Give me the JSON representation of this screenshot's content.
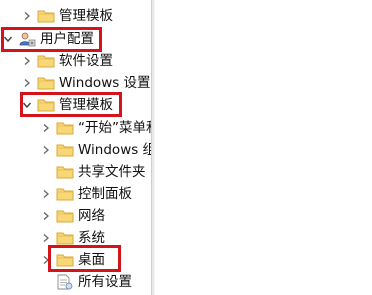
{
  "tree": {
    "items": [
      {
        "label": "管理模板",
        "icon": "folder-icon",
        "expander": "collapsed"
      },
      {
        "label": "用户配置",
        "icon": "user-config-icon",
        "expander": "expanded"
      },
      {
        "label": "软件设置",
        "icon": "folder-icon",
        "expander": "collapsed"
      },
      {
        "label": "Windows 设置",
        "icon": "folder-icon",
        "expander": "collapsed"
      },
      {
        "label": "管理模板",
        "icon": "folder-icon",
        "expander": "expanded"
      },
      {
        "label": "“开始”菜单和",
        "icon": "folder-icon",
        "expander": "collapsed"
      },
      {
        "label": "Windows 组",
        "icon": "folder-icon",
        "expander": "collapsed"
      },
      {
        "label": "共享文件夹",
        "icon": "folder-icon",
        "expander": "none"
      },
      {
        "label": "控制面板",
        "icon": "folder-icon",
        "expander": "collapsed"
      },
      {
        "label": "网络",
        "icon": "folder-icon",
        "expander": "collapsed"
      },
      {
        "label": "系统",
        "icon": "folder-icon",
        "expander": "collapsed"
      },
      {
        "label": "桌面",
        "icon": "folder-icon",
        "expander": "collapsed"
      },
      {
        "label": "所有设置",
        "icon": "all-settings-icon",
        "expander": "none"
      }
    ]
  },
  "colors": {
    "highlight_box": "#d4141b",
    "folder_fill": "#f7d776",
    "folder_edge": "#d9a93a",
    "splitter": "#e9e9e9"
  }
}
